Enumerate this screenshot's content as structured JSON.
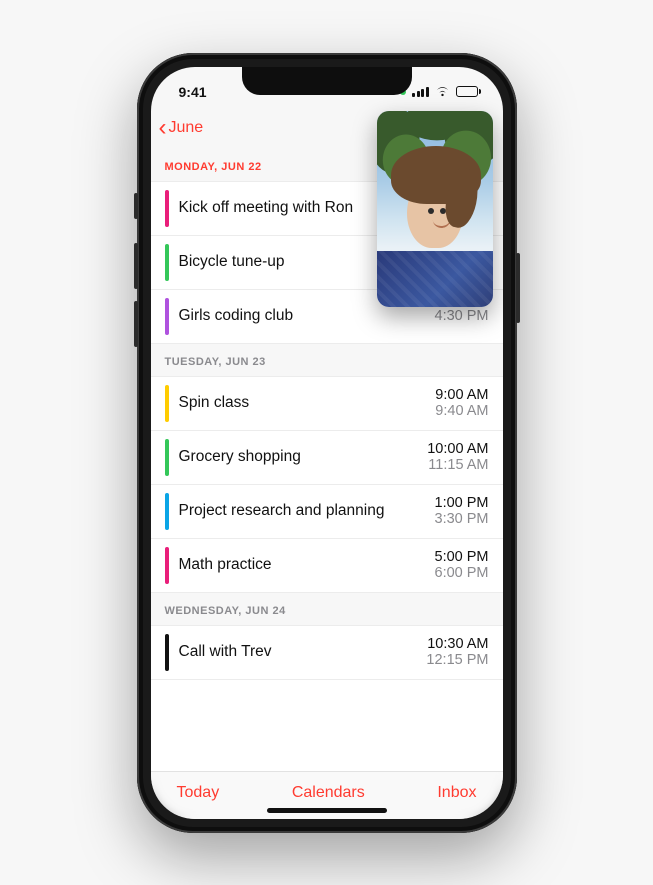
{
  "status": {
    "time": "9:41"
  },
  "nav": {
    "back_label": "June"
  },
  "toolbar": {
    "today": "Today",
    "calendars": "Calendars",
    "inbox": "Inbox"
  },
  "days": [
    {
      "label": "MONDAY, JUN 22",
      "active": true,
      "events": [
        {
          "title": "Kick off meeting with Ron",
          "start": "",
          "end": "",
          "color": "#e91e7a"
        },
        {
          "title": "Bicycle tune-up",
          "start": "",
          "end": "",
          "color": "#34c759"
        },
        {
          "title": "Girls coding club",
          "start": "",
          "end": "4:30 PM",
          "color": "#af52de"
        }
      ]
    },
    {
      "label": "TUESDAY, JUN 23",
      "active": false,
      "events": [
        {
          "title": "Spin class",
          "start": "9:00 AM",
          "end": "9:40 AM",
          "color": "#ffcc00"
        },
        {
          "title": "Grocery shopping",
          "start": "10:00 AM",
          "end": "11:15 AM",
          "color": "#34c759"
        },
        {
          "title": "Project research and planning",
          "start": "1:00 PM",
          "end": "3:30 PM",
          "color": "#0aa5e6"
        },
        {
          "title": "Math practice",
          "start": "5:00 PM",
          "end": "6:00 PM",
          "color": "#e91e7a"
        }
      ]
    },
    {
      "label": "WEDNESDAY, JUN 24",
      "active": false,
      "events": [
        {
          "title": "Call with Trev",
          "start": "10:30 AM",
          "end": "12:15 PM",
          "color": "#111111"
        }
      ]
    }
  ]
}
